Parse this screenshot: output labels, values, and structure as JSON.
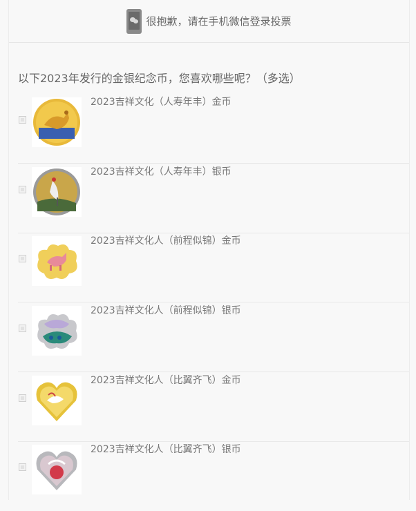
{
  "notice": {
    "text": "很抱歉，请在手机微信登录投票",
    "icon": "wechat-phone-icon"
  },
  "question": {
    "text": "以下2023年发行的金银纪念币，您喜欢哪些呢？（多选）"
  },
  "options": [
    {
      "label": "2023吉祥文化（人寿年丰）金币",
      "coin": "gold-round-deer"
    },
    {
      "label": "2023吉祥文化（人寿年丰）银币",
      "coin": "silver-round-crane"
    },
    {
      "label": "2023吉祥文化人（前程似锦）金币",
      "coin": "gold-cloud-horse"
    },
    {
      "label": "2023吉祥文化人（前程似锦）银币",
      "coin": "silver-cloud-peacock"
    },
    {
      "label": "2023吉祥文化人（比翼齐飞）金币",
      "coin": "gold-heart-cranes"
    },
    {
      "label": "2023吉祥文化人（比翼齐飞）银币",
      "coin": "silver-heart-swans"
    }
  ],
  "colors": {
    "background": "#f8f8f8",
    "text": "#666666",
    "gold": "#e8c23a",
    "silver": "#c8c8c8"
  }
}
